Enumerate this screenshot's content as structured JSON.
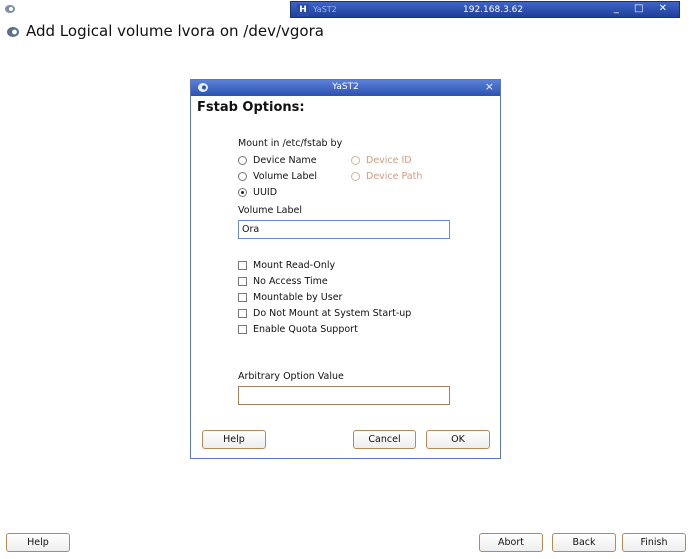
{
  "outer": {
    "remote_app": "YaST2",
    "remote_ip": "192.168.3.62",
    "window_controls": "_ □ ✕"
  },
  "heading": "Add Logical volume lvora on /dev/vgora",
  "buttons": {
    "help": "Help",
    "abort": "Abort",
    "back": "Back",
    "finish": "Finish"
  },
  "dialog": {
    "title": "YaST2",
    "close": "×",
    "heading": "Fstab Options:",
    "mount_by": {
      "label": "Mount in /etc/fstab by",
      "options": [
        {
          "label": "Device Name",
          "checked": false,
          "enabled": true
        },
        {
          "label": "Volume Label",
          "checked": false,
          "enabled": true
        },
        {
          "label": "UUID",
          "checked": true,
          "enabled": true
        },
        {
          "label": "Device ID",
          "checked": false,
          "enabled": false
        },
        {
          "label": "Device Path",
          "checked": false,
          "enabled": false
        }
      ]
    },
    "volume_label": {
      "label": "Volume Label",
      "value": "Ora"
    },
    "checkboxes": [
      {
        "label": "Mount Read-Only",
        "checked": false
      },
      {
        "label": "No Access Time",
        "checked": false
      },
      {
        "label": "Mountable by User",
        "checked": false
      },
      {
        "label": "Do Not Mount at System Start-up",
        "checked": false
      },
      {
        "label": "Enable Quota Support",
        "checked": false
      }
    ],
    "arbitrary": {
      "label": "Arbitrary Option Value",
      "value": ""
    },
    "buttons": {
      "help": "Help",
      "cancel": "Cancel",
      "ok": "OK"
    }
  }
}
